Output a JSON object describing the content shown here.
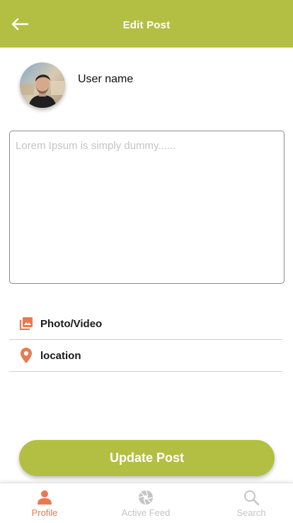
{
  "header": {
    "title": "Edit Post",
    "back_icon": "arrow-left-icon",
    "background": "#b3bf42"
  },
  "user": {
    "name": "User name",
    "avatar_icon": "user-avatar"
  },
  "post": {
    "placeholder": "Lorem Ipsum is simply dummy......",
    "value": ""
  },
  "options": {
    "photo_video": {
      "label": "Photo/Video",
      "icon": "photo-library-icon"
    },
    "location": {
      "label": "location",
      "icon": "map-pin-icon"
    }
  },
  "actions": {
    "update_label": "Update Post"
  },
  "bottom_nav": {
    "items": [
      {
        "label": "Profile",
        "icon": "person-icon",
        "active": true
      },
      {
        "label": "Active Feed",
        "icon": "aperture-icon",
        "active": false
      },
      {
        "label": "Search",
        "icon": "search-icon",
        "active": false
      }
    ]
  },
  "colors": {
    "accent": "#b3bf42",
    "icon_orange": "#e87a52",
    "inactive": "#c4c4c4"
  }
}
